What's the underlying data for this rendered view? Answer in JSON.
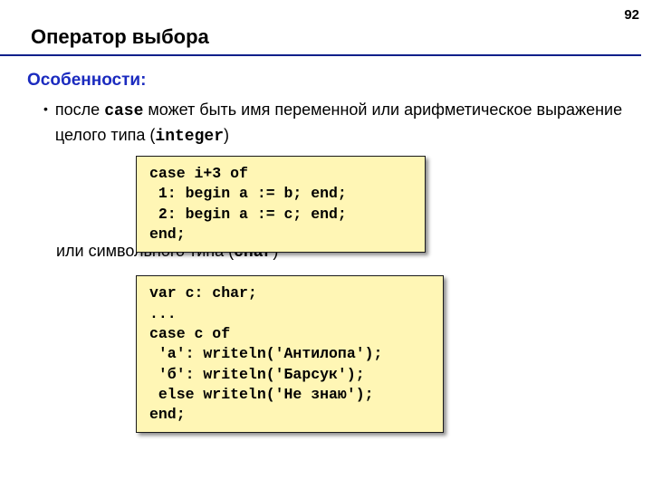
{
  "page": {
    "number": "92",
    "title": "Оператор выбора"
  },
  "subhead": "Особенности:",
  "bullet": {
    "pre": "после ",
    "kw_case": "case",
    "mid": " может быть имя переменной или арифметическое выражение целого типа (",
    "kw_integer": "integer",
    "post": ")"
  },
  "code1": "case i+3 of\n 1: begin a := b; end;\n 2: begin a := c; end;\nend;",
  "midline": {
    "pre": "или символьного типа (",
    "kw_char": "char",
    "post": ")"
  },
  "code2": "var c: char;\n...\ncase c of\n 'а': writeln('Антилопа');\n 'б': writeln('Барсук');\n else writeln('Не знаю');\nend;"
}
